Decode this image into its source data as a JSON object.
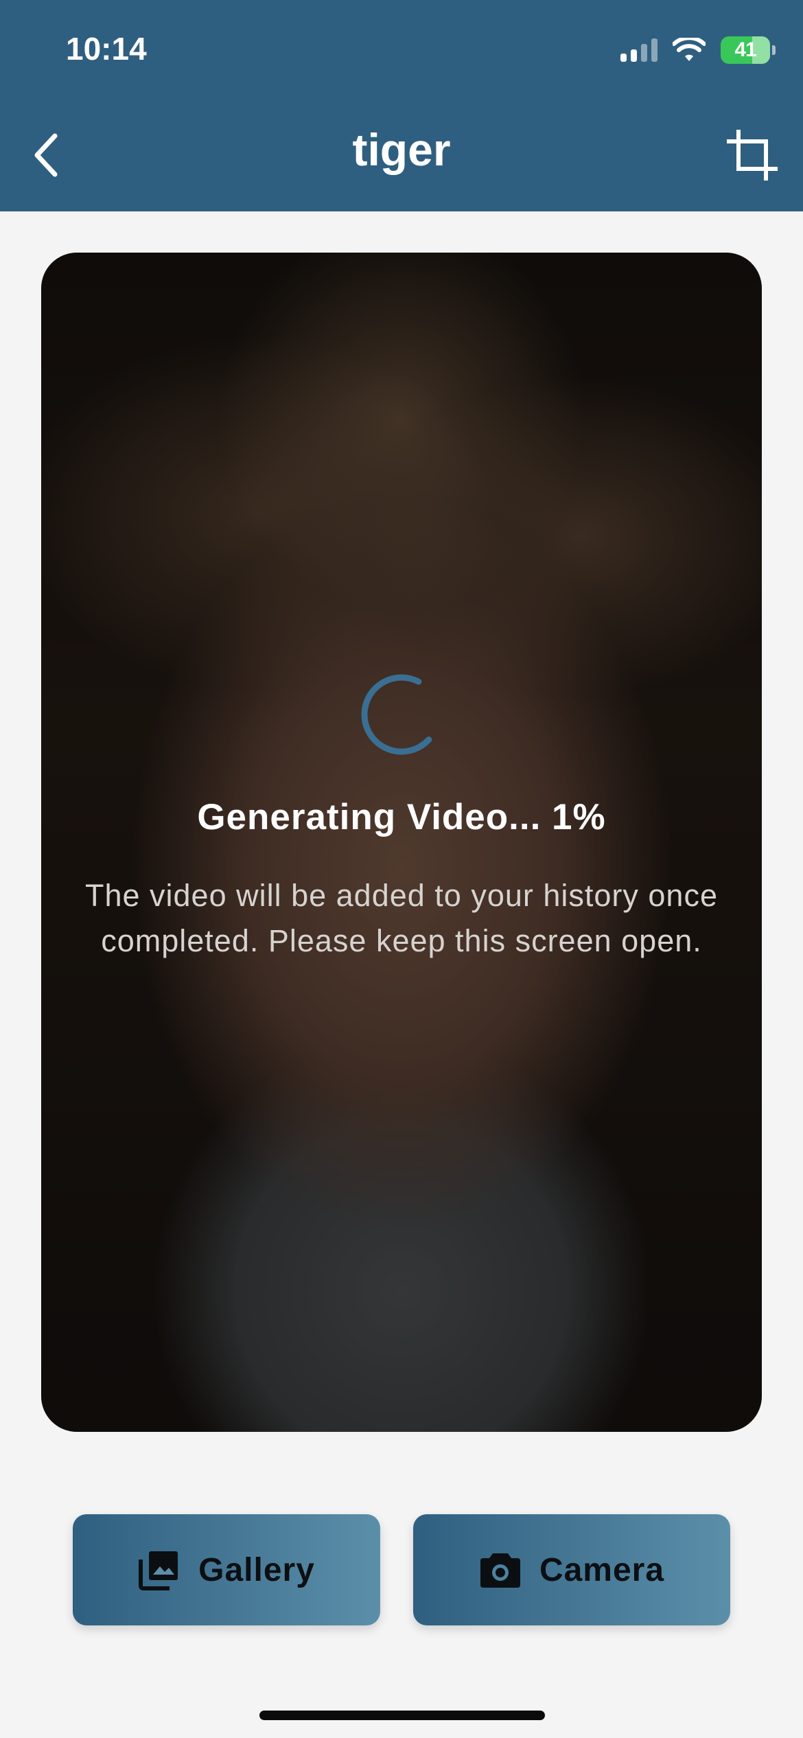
{
  "status_bar": {
    "time": "10:14",
    "battery_percent": "41",
    "icons": [
      "signal-icon",
      "wifi-icon",
      "battery-charging-icon"
    ]
  },
  "header": {
    "title": "tiger",
    "left_icon": "chevron-left-icon",
    "right_icon": "crop-icon"
  },
  "preview": {
    "progress_title": "Generating Video... 1%",
    "progress_percent": 1,
    "message": "The video will be added to your history once completed. Please keep this screen open."
  },
  "actions": {
    "gallery_label": "Gallery",
    "gallery_icon": "photo-library-icon",
    "camera_label": "Camera",
    "camera_icon": "camera-icon"
  },
  "colors": {
    "header_bg": "#2f5f80",
    "accent": "#3a6f93",
    "battery_green": "#39c759"
  }
}
